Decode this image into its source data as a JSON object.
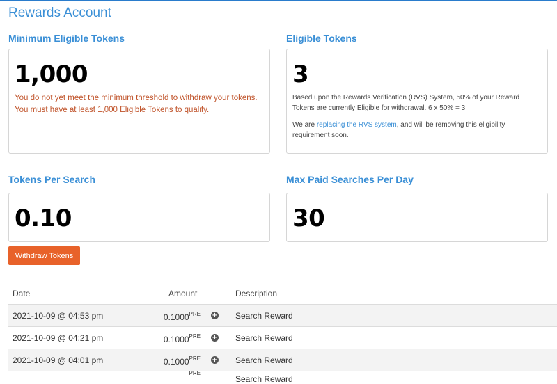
{
  "page": {
    "title": "Rewards Account"
  },
  "min_eligible": {
    "heading": "Minimum Eligible Tokens",
    "value": "1,000",
    "warning_prefix": "You do not yet meet the minimum threshold to withdraw your tokens. You must have at least 1,000 ",
    "warning_link": "Eligible Tokens",
    "warning_suffix": " to qualify."
  },
  "eligible": {
    "heading": "Eligible Tokens",
    "value": "3",
    "info1": "Based upon the Rewards Verification (RVS) System, 50% of your Reward Tokens are currently Eligible for withdrawal. 6 x 50% = 3",
    "info2_prefix": "We are ",
    "info2_link": "replacing the RVS system",
    "info2_suffix": ", and will be removing this eligibility requirement soon."
  },
  "per_search": {
    "heading": "Tokens Per Search",
    "value": "0.10"
  },
  "max_paid": {
    "heading": "Max Paid Searches Per Day",
    "value": "30"
  },
  "withdraw_button": {
    "label": "Withdraw Tokens",
    "color": "#e8622a"
  },
  "table": {
    "headers": {
      "date": "Date",
      "amount": "Amount",
      "description": "Description"
    },
    "rows": [
      {
        "date": "2021-10-09 @ 04:53 pm",
        "amount": "0.1000",
        "unit": "PRE",
        "description": "Search Reward"
      },
      {
        "date": "2021-10-09 @ 04:21 pm",
        "amount": "0.1000",
        "unit": "PRE",
        "description": "Search Reward"
      },
      {
        "date": "2021-10-09 @ 04:01 pm",
        "amount": "0.1000",
        "unit": "PRE",
        "description": "Search Reward"
      },
      {
        "date": "",
        "amount": "",
        "unit": "PRE",
        "description": "Search Reward"
      }
    ]
  },
  "colors": {
    "accent": "#3a8fd6",
    "warning": "#c0532a"
  }
}
